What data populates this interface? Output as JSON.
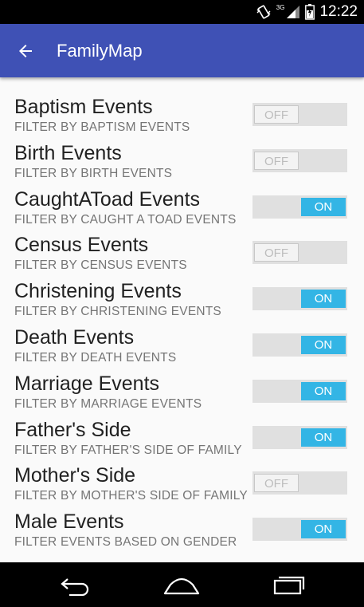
{
  "status_bar": {
    "time": "12:22",
    "network": "3G",
    "icons": [
      "vibrate-icon",
      "signal-icon",
      "battery-icon"
    ]
  },
  "app_bar": {
    "title": "FamilyMap",
    "back_icon": "arrow-back-icon",
    "color": "#3f51b5"
  },
  "filters": [
    {
      "title": "Baptism Events",
      "subtitle": "FILTER BY BAPTISM EVENTS",
      "on": false,
      "label": "OFF"
    },
    {
      "title": "Birth Events",
      "subtitle": "FILTER BY BIRTH EVENTS",
      "on": false,
      "label": "OFF"
    },
    {
      "title": "CaughtAToad Events",
      "subtitle": "FILTER BY CAUGHT A TOAD EVENTS",
      "on": true,
      "label": "ON"
    },
    {
      "title": "Census Events",
      "subtitle": "FILTER BY CENSUS EVENTS",
      "on": false,
      "label": "OFF"
    },
    {
      "title": "Christening Events",
      "subtitle": "FILTER BY CHRISTENING EVENTS",
      "on": true,
      "label": "ON"
    },
    {
      "title": "Death Events",
      "subtitle": "FILTER BY DEATH EVENTS",
      "on": true,
      "label": "ON"
    },
    {
      "title": "Marriage Events",
      "subtitle": "FILTER BY MARRIAGE EVENTS",
      "on": true,
      "label": "ON"
    },
    {
      "title": "Father's Side",
      "subtitle": "FILTER BY FATHER'S SIDE OF FAMILY",
      "on": true,
      "label": "ON"
    },
    {
      "title": "Mother's Side",
      "subtitle": "FILTER BY MOTHER'S SIDE OF FAMILY",
      "on": false,
      "label": "OFF"
    },
    {
      "title": "Male Events",
      "subtitle": "FILTER EVENTS BASED ON GENDER",
      "on": true,
      "label": "ON"
    }
  ],
  "toggle_colors": {
    "on": "#33b5e5",
    "off_track": "#e0e0e0"
  },
  "nav_bar": {
    "icons": [
      "nav-back-icon",
      "nav-home-icon",
      "nav-recents-icon"
    ]
  }
}
